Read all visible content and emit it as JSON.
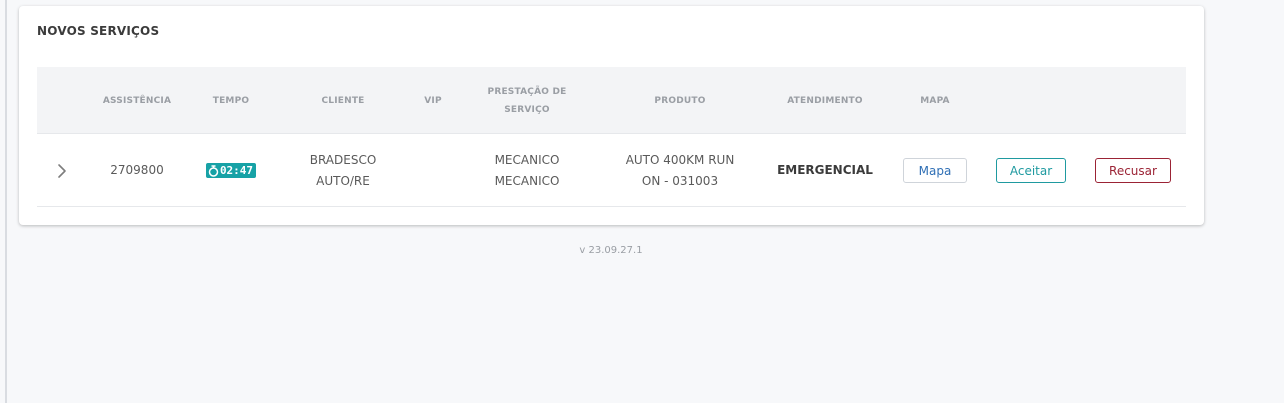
{
  "card": {
    "title": "NOVOS SERVIÇOS"
  },
  "table": {
    "headers": {
      "assistencia": "ASSISTÊNCIA",
      "tempo": "TEMPO",
      "cliente": "CLIENTE",
      "vip": "VIP",
      "prestacao_line1": "PRESTAÇÃO DE",
      "prestacao_line2": "SERVIÇO",
      "produto": "PRODUTO",
      "atendimento": "ATENDIMENTO",
      "mapa": "MAPA"
    },
    "rows": [
      {
        "expand_icon": "chevron-right-icon",
        "assistencia": "2709800",
        "tempo": "02:47",
        "cliente_line1": "BRADESCO",
        "cliente_line2": "AUTO/RE",
        "vip": "",
        "prestacao_line1": "MECANICO",
        "prestacao_line2": "MECANICO",
        "produto_line1": "AUTO 400KM RUN",
        "produto_line2": "ON - 031003",
        "atendimento": "EMERGENCIAL",
        "mapa_label": "Mapa",
        "aceitar_label": "Aceitar",
        "recusar_label": "Recusar"
      }
    ]
  },
  "footer": {
    "version": "v 23.09.27.1"
  },
  "colors": {
    "timer_bg": "#17a2a6",
    "aceitar": "#1f9aa0",
    "recusar": "#9b2335",
    "mapa_text": "#2f6fb5"
  }
}
